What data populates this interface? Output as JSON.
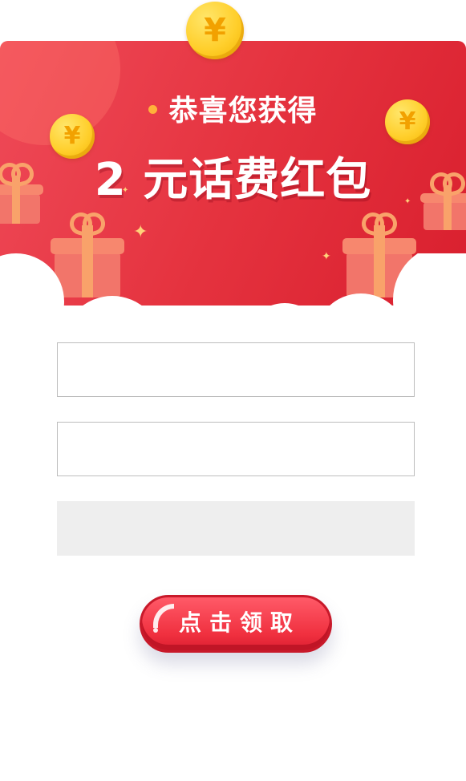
{
  "banner": {
    "headline": "恭喜您获得",
    "prize": "2 元话费红包"
  },
  "coin_symbol": "¥",
  "form": {
    "field1_placeholder": "",
    "field2_placeholder": "",
    "field3_placeholder": ""
  },
  "claim_button": {
    "label": "点击领取"
  },
  "colors": {
    "banner_red": "#e5333f",
    "coin_gold": "#ffcf2c",
    "button_red": "#f0303f"
  }
}
